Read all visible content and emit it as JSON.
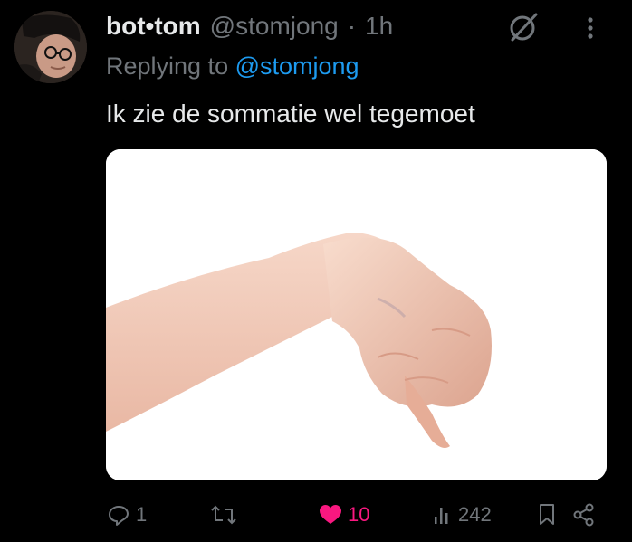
{
  "tweet": {
    "author": {
      "display_name": "bot•tom",
      "handle": "@stomjong",
      "separator": "·",
      "time": "1h"
    },
    "reply_prefix": "Replying to",
    "reply_to": "@stomjong",
    "text": "Ik zie de sommatie wel tegemoet"
  },
  "actions": {
    "replies": "1",
    "likes": "10",
    "views": "242"
  },
  "colors": {
    "background": "#000000",
    "text": "#e7e9ea",
    "muted": "#71767b",
    "link": "#1d9bf0",
    "like": "#f91880"
  },
  "icons": [
    "avatar",
    "grok-icon",
    "more-icon",
    "reply-icon",
    "repost-icon",
    "heart-icon",
    "views-icon",
    "bookmark-icon",
    "share-icon"
  ]
}
